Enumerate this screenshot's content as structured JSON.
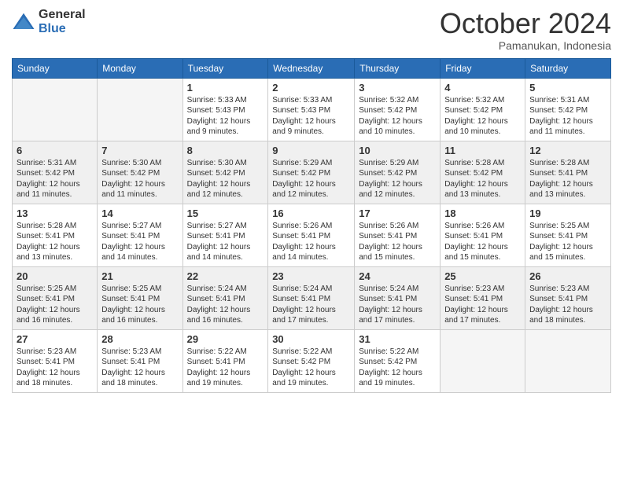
{
  "logo": {
    "general": "General",
    "blue": "Blue"
  },
  "header": {
    "month": "October 2024",
    "location": "Pamanukan, Indonesia"
  },
  "weekdays": [
    "Sunday",
    "Monday",
    "Tuesday",
    "Wednesday",
    "Thursday",
    "Friday",
    "Saturday"
  ],
  "weeks": [
    [
      {
        "day": "",
        "empty": true
      },
      {
        "day": "",
        "empty": true
      },
      {
        "day": "1",
        "sunrise": "Sunrise: 5:33 AM",
        "sunset": "Sunset: 5:43 PM",
        "daylight": "Daylight: 12 hours and 9 minutes."
      },
      {
        "day": "2",
        "sunrise": "Sunrise: 5:33 AM",
        "sunset": "Sunset: 5:43 PM",
        "daylight": "Daylight: 12 hours and 9 minutes."
      },
      {
        "day": "3",
        "sunrise": "Sunrise: 5:32 AM",
        "sunset": "Sunset: 5:42 PM",
        "daylight": "Daylight: 12 hours and 10 minutes."
      },
      {
        "day": "4",
        "sunrise": "Sunrise: 5:32 AM",
        "sunset": "Sunset: 5:42 PM",
        "daylight": "Daylight: 12 hours and 10 minutes."
      },
      {
        "day": "5",
        "sunrise": "Sunrise: 5:31 AM",
        "sunset": "Sunset: 5:42 PM",
        "daylight": "Daylight: 12 hours and 11 minutes."
      }
    ],
    [
      {
        "day": "6",
        "sunrise": "Sunrise: 5:31 AM",
        "sunset": "Sunset: 5:42 PM",
        "daylight": "Daylight: 12 hours and 11 minutes."
      },
      {
        "day": "7",
        "sunrise": "Sunrise: 5:30 AM",
        "sunset": "Sunset: 5:42 PM",
        "daylight": "Daylight: 12 hours and 11 minutes."
      },
      {
        "day": "8",
        "sunrise": "Sunrise: 5:30 AM",
        "sunset": "Sunset: 5:42 PM",
        "daylight": "Daylight: 12 hours and 12 minutes."
      },
      {
        "day": "9",
        "sunrise": "Sunrise: 5:29 AM",
        "sunset": "Sunset: 5:42 PM",
        "daylight": "Daylight: 12 hours and 12 minutes."
      },
      {
        "day": "10",
        "sunrise": "Sunrise: 5:29 AM",
        "sunset": "Sunset: 5:42 PM",
        "daylight": "Daylight: 12 hours and 12 minutes."
      },
      {
        "day": "11",
        "sunrise": "Sunrise: 5:28 AM",
        "sunset": "Sunset: 5:42 PM",
        "daylight": "Daylight: 12 hours and 13 minutes."
      },
      {
        "day": "12",
        "sunrise": "Sunrise: 5:28 AM",
        "sunset": "Sunset: 5:41 PM",
        "daylight": "Daylight: 12 hours and 13 minutes."
      }
    ],
    [
      {
        "day": "13",
        "sunrise": "Sunrise: 5:28 AM",
        "sunset": "Sunset: 5:41 PM",
        "daylight": "Daylight: 12 hours and 13 minutes."
      },
      {
        "day": "14",
        "sunrise": "Sunrise: 5:27 AM",
        "sunset": "Sunset: 5:41 PM",
        "daylight": "Daylight: 12 hours and 14 minutes."
      },
      {
        "day": "15",
        "sunrise": "Sunrise: 5:27 AM",
        "sunset": "Sunset: 5:41 PM",
        "daylight": "Daylight: 12 hours and 14 minutes."
      },
      {
        "day": "16",
        "sunrise": "Sunrise: 5:26 AM",
        "sunset": "Sunset: 5:41 PM",
        "daylight": "Daylight: 12 hours and 14 minutes."
      },
      {
        "day": "17",
        "sunrise": "Sunrise: 5:26 AM",
        "sunset": "Sunset: 5:41 PM",
        "daylight": "Daylight: 12 hours and 15 minutes."
      },
      {
        "day": "18",
        "sunrise": "Sunrise: 5:26 AM",
        "sunset": "Sunset: 5:41 PM",
        "daylight": "Daylight: 12 hours and 15 minutes."
      },
      {
        "day": "19",
        "sunrise": "Sunrise: 5:25 AM",
        "sunset": "Sunset: 5:41 PM",
        "daylight": "Daylight: 12 hours and 15 minutes."
      }
    ],
    [
      {
        "day": "20",
        "sunrise": "Sunrise: 5:25 AM",
        "sunset": "Sunset: 5:41 PM",
        "daylight": "Daylight: 12 hours and 16 minutes."
      },
      {
        "day": "21",
        "sunrise": "Sunrise: 5:25 AM",
        "sunset": "Sunset: 5:41 PM",
        "daylight": "Daylight: 12 hours and 16 minutes."
      },
      {
        "day": "22",
        "sunrise": "Sunrise: 5:24 AM",
        "sunset": "Sunset: 5:41 PM",
        "daylight": "Daylight: 12 hours and 16 minutes."
      },
      {
        "day": "23",
        "sunrise": "Sunrise: 5:24 AM",
        "sunset": "Sunset: 5:41 PM",
        "daylight": "Daylight: 12 hours and 17 minutes."
      },
      {
        "day": "24",
        "sunrise": "Sunrise: 5:24 AM",
        "sunset": "Sunset: 5:41 PM",
        "daylight": "Daylight: 12 hours and 17 minutes."
      },
      {
        "day": "25",
        "sunrise": "Sunrise: 5:23 AM",
        "sunset": "Sunset: 5:41 PM",
        "daylight": "Daylight: 12 hours and 17 minutes."
      },
      {
        "day": "26",
        "sunrise": "Sunrise: 5:23 AM",
        "sunset": "Sunset: 5:41 PM",
        "daylight": "Daylight: 12 hours and 18 minutes."
      }
    ],
    [
      {
        "day": "27",
        "sunrise": "Sunrise: 5:23 AM",
        "sunset": "Sunset: 5:41 PM",
        "daylight": "Daylight: 12 hours and 18 minutes."
      },
      {
        "day": "28",
        "sunrise": "Sunrise: 5:23 AM",
        "sunset": "Sunset: 5:41 PM",
        "daylight": "Daylight: 12 hours and 18 minutes."
      },
      {
        "day": "29",
        "sunrise": "Sunrise: 5:22 AM",
        "sunset": "Sunset: 5:41 PM",
        "daylight": "Daylight: 12 hours and 19 minutes."
      },
      {
        "day": "30",
        "sunrise": "Sunrise: 5:22 AM",
        "sunset": "Sunset: 5:42 PM",
        "daylight": "Daylight: 12 hours and 19 minutes."
      },
      {
        "day": "31",
        "sunrise": "Sunrise: 5:22 AM",
        "sunset": "Sunset: 5:42 PM",
        "daylight": "Daylight: 12 hours and 19 minutes."
      },
      {
        "day": "",
        "empty": true
      },
      {
        "day": "",
        "empty": true
      }
    ]
  ]
}
